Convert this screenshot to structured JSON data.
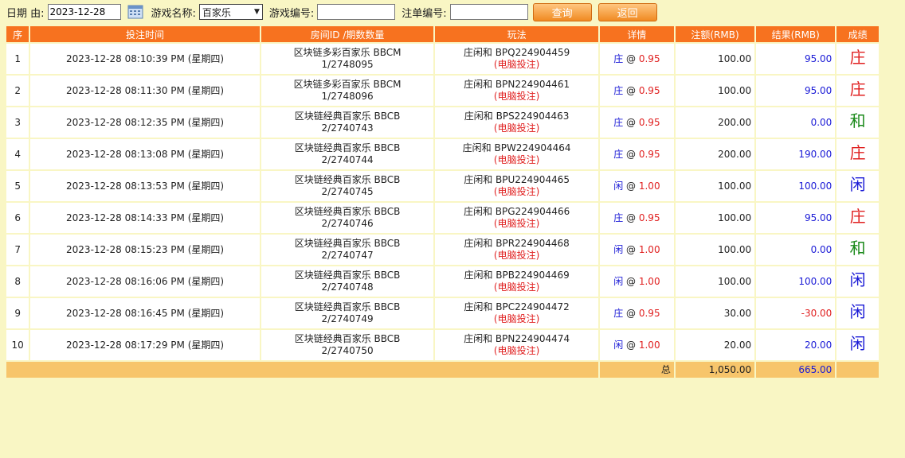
{
  "toolbar": {
    "date_label": "日期 由:",
    "date_value": "2023-12-28",
    "game_name_label": "游戏名称:",
    "game_name_selected": "百家乐",
    "game_code_label": "游戏编号:",
    "order_code_label": "注单编号:",
    "query_label": "查询",
    "back_label": "返回"
  },
  "table": {
    "headers": [
      "序",
      "投注时间",
      "房间ID /期数数量",
      "玩法",
      "详情",
      "注额(RMB)",
      "结果(RMB)",
      "成绩"
    ],
    "rows": [
      {
        "seq": "1",
        "time": "2023-12-28 08:10:39 PM (星期四)",
        "room": "区块链多彩百家乐 BBCM",
        "period": "1/2748095",
        "play": "庄闲和 BPQ224904459",
        "mode": "(电脑投注)",
        "side": "庄",
        "at": "@",
        "odds": "0.95",
        "bet": "100.00",
        "result": "95.00",
        "outcome": "庄"
      },
      {
        "seq": "2",
        "time": "2023-12-28 08:11:30 PM (星期四)",
        "room": "区块链多彩百家乐 BBCM",
        "period": "1/2748096",
        "play": "庄闲和 BPN224904461",
        "mode": "(电脑投注)",
        "side": "庄",
        "at": "@",
        "odds": "0.95",
        "bet": "100.00",
        "result": "95.00",
        "outcome": "庄"
      },
      {
        "seq": "3",
        "time": "2023-12-28 08:12:35 PM (星期四)",
        "room": "区块链经典百家乐 BBCB",
        "period": "2/2740743",
        "play": "庄闲和 BPS224904463",
        "mode": "(电脑投注)",
        "side": "庄",
        "at": "@",
        "odds": "0.95",
        "bet": "200.00",
        "result": "0.00",
        "outcome": "和"
      },
      {
        "seq": "4",
        "time": "2023-12-28 08:13:08 PM (星期四)",
        "room": "区块链经典百家乐 BBCB",
        "period": "2/2740744",
        "play": "庄闲和 BPW224904464",
        "mode": "(电脑投注)",
        "side": "庄",
        "at": "@",
        "odds": "0.95",
        "bet": "200.00",
        "result": "190.00",
        "outcome": "庄"
      },
      {
        "seq": "5",
        "time": "2023-12-28 08:13:53 PM (星期四)",
        "room": "区块链经典百家乐 BBCB",
        "period": "2/2740745",
        "play": "庄闲和 BPU224904465",
        "mode": "(电脑投注)",
        "side": "闲",
        "at": "@",
        "odds": "1.00",
        "bet": "100.00",
        "result": "100.00",
        "outcome": "闲"
      },
      {
        "seq": "6",
        "time": "2023-12-28 08:14:33 PM (星期四)",
        "room": "区块链经典百家乐 BBCB",
        "period": "2/2740746",
        "play": "庄闲和 BPG224904466",
        "mode": "(电脑投注)",
        "side": "庄",
        "at": "@",
        "odds": "0.95",
        "bet": "100.00",
        "result": "95.00",
        "outcome": "庄"
      },
      {
        "seq": "7",
        "time": "2023-12-28 08:15:23 PM (星期四)",
        "room": "区块链经典百家乐 BBCB",
        "period": "2/2740747",
        "play": "庄闲和 BPR224904468",
        "mode": "(电脑投注)",
        "side": "闲",
        "at": "@",
        "odds": "1.00",
        "bet": "100.00",
        "result": "0.00",
        "outcome": "和"
      },
      {
        "seq": "8",
        "time": "2023-12-28 08:16:06 PM (星期四)",
        "room": "区块链经典百家乐 BBCB",
        "period": "2/2740748",
        "play": "庄闲和 BPB224904469",
        "mode": "(电脑投注)",
        "side": "闲",
        "at": "@",
        "odds": "1.00",
        "bet": "100.00",
        "result": "100.00",
        "outcome": "闲"
      },
      {
        "seq": "9",
        "time": "2023-12-28 08:16:45 PM (星期四)",
        "room": "区块链经典百家乐 BBCB",
        "period": "2/2740749",
        "play": "庄闲和 BPC224904472",
        "mode": "(电脑投注)",
        "side": "庄",
        "at": "@",
        "odds": "0.95",
        "bet": "30.00",
        "result": "-30.00",
        "outcome": "闲"
      },
      {
        "seq": "10",
        "time": "2023-12-28 08:17:29 PM (星期四)",
        "room": "区块链经典百家乐 BBCB",
        "period": "2/2740750",
        "play": "庄闲和 BPN224904474",
        "mode": "(电脑投注)",
        "side": "闲",
        "at": "@",
        "odds": "1.00",
        "bet": "20.00",
        "result": "20.00",
        "outcome": "闲"
      }
    ],
    "total": {
      "label": "总",
      "bet": "1,050.00",
      "result": "665.00"
    }
  },
  "colors": {
    "page_bg": "#f9f6c4",
    "header_bg": "#f7721f",
    "total_bg": "#f7c56b",
    "banker": "#e02020",
    "player": "#1a1ad6",
    "tie": "#1b8a1b",
    "negative": "#e02020"
  }
}
